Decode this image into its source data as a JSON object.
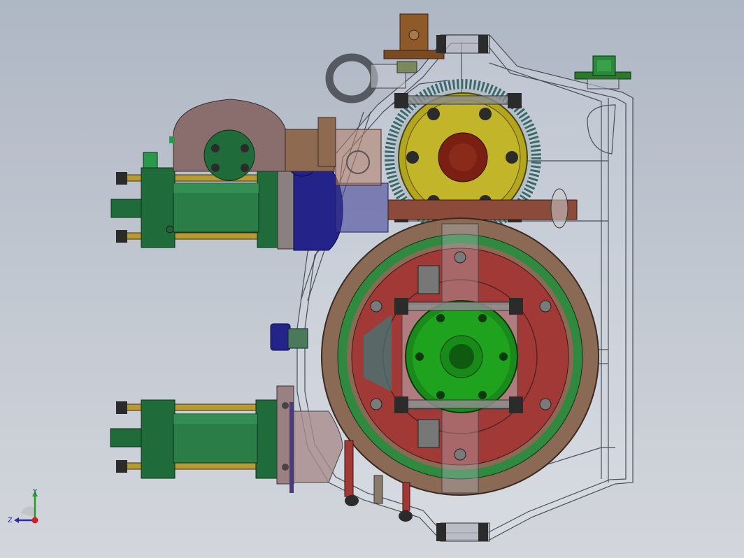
{
  "viewport": {
    "background_top": "#aeb7c4",
    "background_bottom": "#d3d6dc"
  },
  "colors": {
    "housing_line": "#4a4f58",
    "cylinder_green": "#1f6b3a",
    "rod_brass": "#b89a35",
    "nut_dark": "#2b2b2b",
    "gear_yellow": "#b3a51e",
    "bore_red": "#7a1f12",
    "wheel_brown": "#8a6a55",
    "wheel_red": "#a13a36",
    "hub_green": "#1fa31f",
    "motor_blue": "#23238a",
    "bracket_mauve": "#8a6e6e",
    "eyebolt_gray": "#555a60",
    "top_block_brown": "#8e5a2a",
    "shaft_rust": "#8b4a3a"
  },
  "triad": {
    "x_icon": "axis-x-icon",
    "y_label": "Y",
    "z_label": "Z"
  }
}
